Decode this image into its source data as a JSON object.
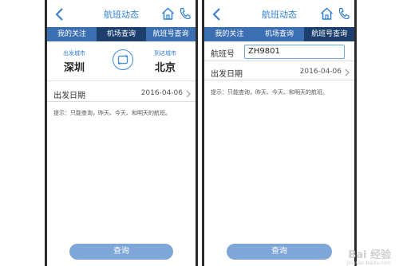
{
  "left": {
    "title": "航班动态",
    "tabs": [
      "我的关注",
      "机场查询",
      "航班号查询"
    ],
    "active_tab": 1,
    "depart_label": "出发城市",
    "depart_city": "深圳",
    "arrive_label": "到达城市",
    "arrive_city": "北京",
    "date_label": "出发日期",
    "date_value": "2016-04-06",
    "hint": "提示：只能查询，昨天、今天、和明天的航班。",
    "button": "查询"
  },
  "right": {
    "title": "航班动态",
    "tabs": [
      "我的关注",
      "机场查询",
      "航班号查询"
    ],
    "active_tab": 2,
    "flight_label": "航班号",
    "flight_value": "ZH9801",
    "date_label": "出发日期",
    "date_value": "2016-04-06",
    "hint": "提示：只能查询，昨天、今天、和明天的航班。",
    "button": "查询"
  },
  "watermark": "Bai 经验",
  "watermark_sub": "jingyan.baidu.com",
  "colors": {
    "accent": "#2f7fd6",
    "tab_bg": "#3c6fb1",
    "tab_active": "#1c3f6e",
    "button": "#7ea6d8"
  }
}
